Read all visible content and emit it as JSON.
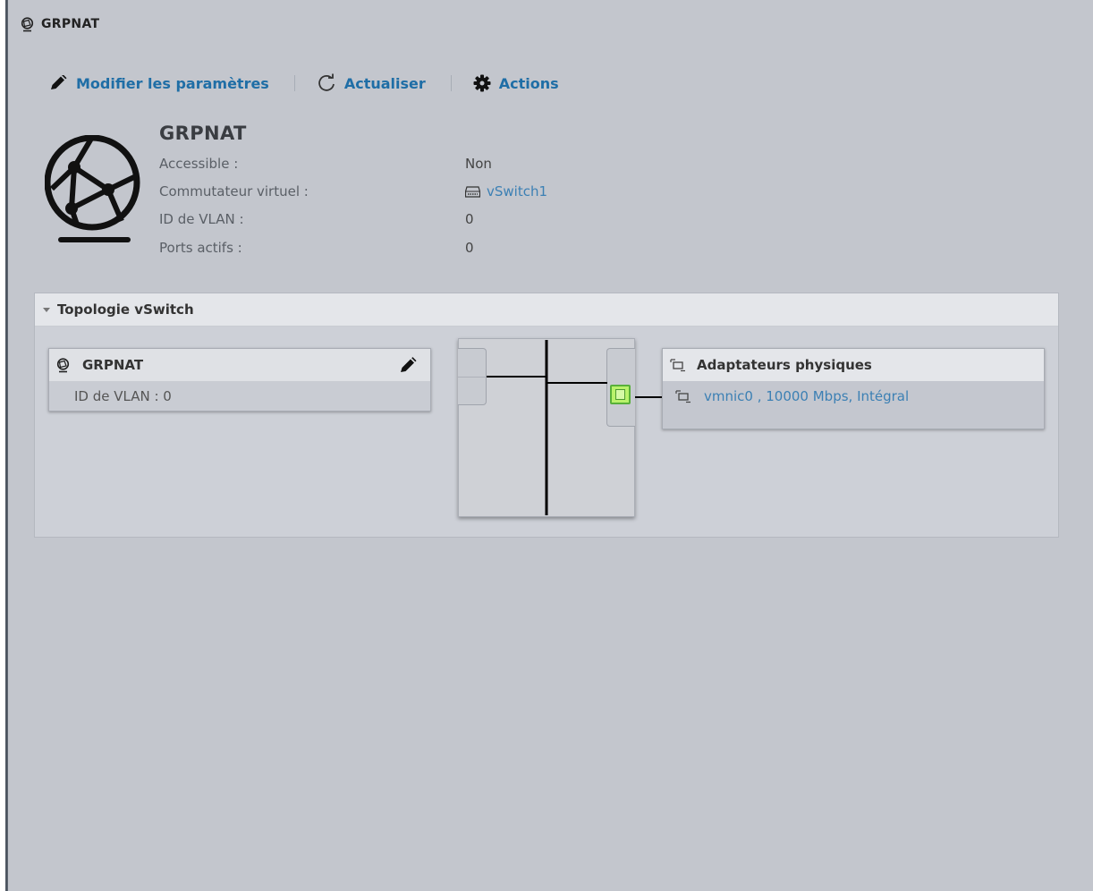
{
  "window": {
    "title": "GRPNAT",
    "title_icon": "network-globe-icon"
  },
  "toolbar": {
    "edit": {
      "label": "Modifier les paramètres",
      "icon": "pencil-icon"
    },
    "refresh": {
      "label": "Actualiser",
      "icon": "refresh-icon"
    },
    "actions": {
      "label": "Actions",
      "icon": "gear-icon"
    }
  },
  "header": {
    "name": "GRPNAT",
    "icon": "network-globe-icon",
    "properties": {
      "accessible": {
        "label": "Accessible :",
        "value": "Non"
      },
      "vswitch": {
        "label": "Commutateur virtuel :",
        "value": "vSwitch1",
        "icon": "switch-icon"
      },
      "vlan": {
        "label": "ID de VLAN :",
        "value": "0"
      },
      "ports": {
        "label": "Ports actifs :",
        "value": "0"
      }
    }
  },
  "topology": {
    "title": "Topologie vSwitch",
    "port_group": {
      "name": "GRPNAT",
      "vlan_text": "ID de VLAN : 0"
    },
    "adapters": {
      "title": "Adaptateurs physiques",
      "items": [
        {
          "text": "vmnic0 , 10000 Mbps, Intégral",
          "status": "connected"
        }
      ]
    }
  },
  "colors": {
    "link": "#1f6ea6",
    "port_active": "#b9f26b",
    "background": "#c3c6cd"
  }
}
